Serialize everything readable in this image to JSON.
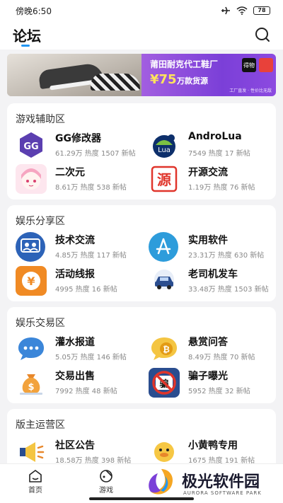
{
  "status_bar": {
    "time": "傍晚6:50",
    "battery": "78"
  },
  "header": {
    "title": "论坛"
  },
  "banner": {
    "title": "莆田耐克代工鞋厂",
    "price": "¥75",
    "subtitle": "万款货源",
    "tagline": "工厂直发 · 性价比无敌",
    "brand_mark": "得物"
  },
  "sections": [
    {
      "title": "游戏辅助区",
      "items": [
        {
          "name": "GG修改器",
          "stats": "61.29万 热度 1507 新帖",
          "icon": "gg-modifier-icon"
        },
        {
          "name": "AndroLua",
          "stats": "7549 热度 17 新帖",
          "icon": "androlua-icon"
        },
        {
          "name": "二次元",
          "stats": "8.61万 热度 538 新帖",
          "icon": "anime-girl-icon"
        },
        {
          "name": "开源交流",
          "stats": "1.19万 热度 76 新帖",
          "icon": "open-source-icon"
        }
      ]
    },
    {
      "title": "娱乐分享区",
      "items": [
        {
          "name": "技术交流",
          "stats": "4.85万 热度 117 新帖",
          "icon": "people-chat-icon"
        },
        {
          "name": "实用软件",
          "stats": "23.31万 热度 630 新帖",
          "icon": "app-store-icon"
        },
        {
          "name": "活动线报",
          "stats": "4995 热度 16 新帖",
          "icon": "yen-coin-icon"
        },
        {
          "name": "老司机发车",
          "stats": "33.48万 热度 1503 新帖",
          "icon": "car-icon"
        }
      ]
    },
    {
      "title": "娱乐交易区",
      "items": [
        {
          "name": "灌水报道",
          "stats": "5.05万 热度 146 新帖",
          "icon": "chat-bubble-icon"
        },
        {
          "name": "悬赏问答",
          "stats": "8.49万 热度 70 新帖",
          "icon": "bitcoin-bubble-icon"
        },
        {
          "name": "交易出售",
          "stats": "7992 热度 48 新帖",
          "icon": "money-bag-icon"
        },
        {
          "name": "骗子曝光",
          "stats": "5952 热度 32 新帖",
          "icon": "no-scam-icon"
        }
      ]
    },
    {
      "title": "版主运营区",
      "items": [
        {
          "name": "社区公告",
          "stats": "18.58万 热度 398 新帖",
          "icon": "megaphone-icon"
        },
        {
          "name": "小黄鸭专用",
          "stats": "1675 热度 191 新帖",
          "icon": "yellow-duck-icon"
        }
      ]
    }
  ],
  "bottom_nav": [
    {
      "label": "首页",
      "icon": "home-icon"
    },
    {
      "label": "游戏",
      "icon": "gamepad-icon"
    }
  ],
  "watermark": {
    "text": "极光软件园",
    "sub": "AURORA SOFTWARE PARK"
  }
}
